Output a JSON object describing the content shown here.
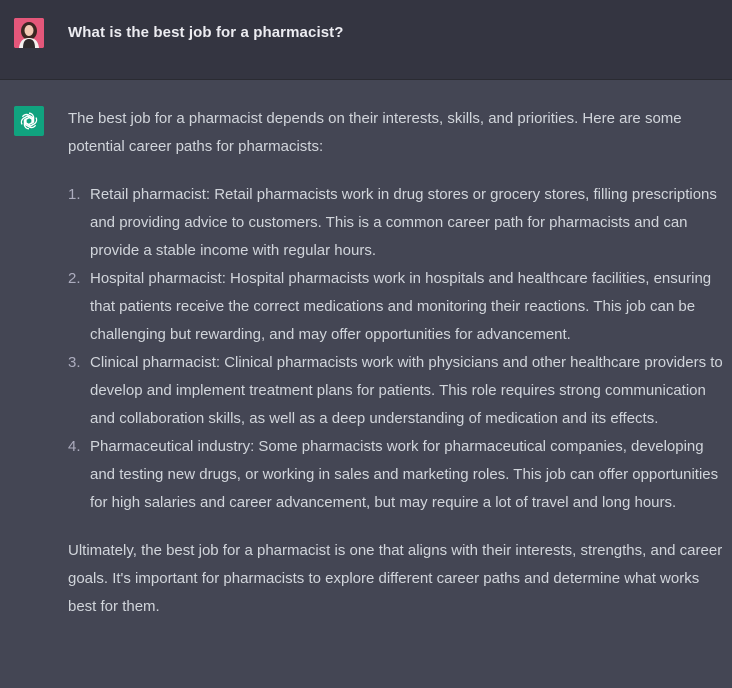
{
  "conversation": {
    "user": {
      "avatar_icon": "user-avatar-photo",
      "message": "What is the best job for a pharmacist?"
    },
    "assistant": {
      "avatar_icon": "openai-logo-icon",
      "avatar_color": "#10a37f",
      "intro": "The best job for a pharmacist depends on their interests, skills, and priorities. Here are some potential career paths for pharmacists:",
      "items": [
        {
          "number": "1.",
          "text": "Retail pharmacist: Retail pharmacists work in drug stores or grocery stores, filling prescriptions and providing advice to customers. This is a common career path for pharmacists and can provide a stable income with regular hours."
        },
        {
          "number": "2.",
          "text": "Hospital pharmacist: Hospital pharmacists work in hospitals and healthcare facilities, ensuring that patients receive the correct medications and monitoring their reactions. This job can be challenging but rewarding, and may offer opportunities for advancement."
        },
        {
          "number": "3.",
          "text": "Clinical pharmacist: Clinical pharmacists work with physicians and other healthcare providers to develop and implement treatment plans for patients. This role requires strong communication and collaboration skills, as well as a deep understanding of medication and its effects."
        },
        {
          "number": "4.",
          "text": "Pharmaceutical industry: Some pharmacists work for pharmaceutical companies, developing and testing new drugs, or working in sales and marketing roles. This job can offer opportunities for high salaries and career advancement, but may require a lot of travel and long hours."
        }
      ],
      "conclusion": "Ultimately, the best job for a pharmacist is one that aligns with their interests, strengths, and career goals. It's important for pharmacists to explore different career paths and determine what works best for them."
    }
  },
  "colors": {
    "user_row_bg": "#343541",
    "assistant_row_bg": "#444654",
    "text": "#d1d5db",
    "user_avatar": "#e94b6e"
  }
}
